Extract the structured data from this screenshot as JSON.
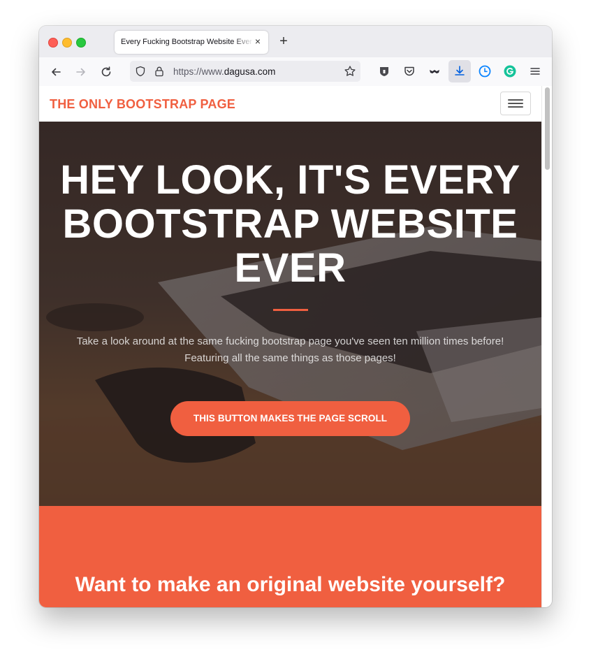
{
  "browser": {
    "tab": {
      "title": "Every Fucking Bootstrap Website Ever",
      "close_label": "×"
    },
    "new_tab_label": "+",
    "url": {
      "scheme": "https://www.",
      "host": "dagusa.com"
    }
  },
  "site": {
    "brand": "THE ONLY BOOTSTRAP PAGE",
    "hero": {
      "title": "HEY LOOK, IT'S EVERY BOOTSTRAP WEBSITE EVER",
      "subtitle": "Take a look around at the same fucking bootstrap page you've seen ten million times before! Featuring all the same things as those pages!",
      "button_label": "THIS BUTTON MAKES THE PAGE SCROLL"
    },
    "cta": {
      "title": "Want to make an original website yourself?"
    }
  },
  "colors": {
    "accent": "#f05f40",
    "hero_dark": "#3f3433"
  }
}
